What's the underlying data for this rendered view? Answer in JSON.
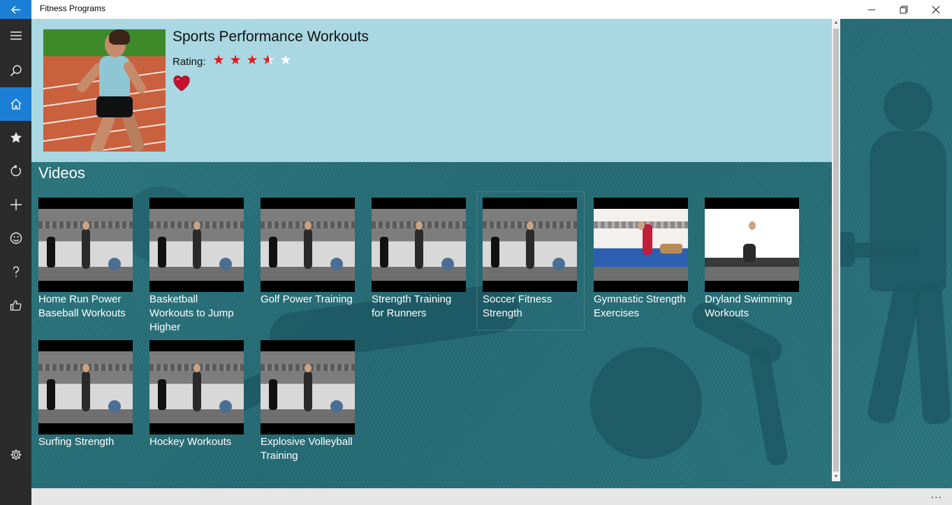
{
  "window": {
    "title": "Fitness Programs",
    "back_icon": "back-arrow-icon",
    "minimize_glyph": "—",
    "maximize_glyph": "❐",
    "close_glyph": "✕"
  },
  "nav": {
    "items": [
      {
        "name": "menu",
        "icon": "hamburger-icon",
        "active": false
      },
      {
        "name": "search",
        "icon": "search-icon",
        "active": false
      },
      {
        "name": "home",
        "icon": "home-icon",
        "active": true
      },
      {
        "name": "favorites",
        "icon": "star-icon",
        "active": false
      },
      {
        "name": "refresh",
        "icon": "refresh-icon",
        "active": false
      },
      {
        "name": "add",
        "icon": "plus-icon",
        "active": false
      },
      {
        "name": "feedback",
        "icon": "smiley-icon",
        "active": false
      },
      {
        "name": "help",
        "icon": "help-icon",
        "active": false
      },
      {
        "name": "like",
        "icon": "thumbs-up-icon",
        "active": false
      },
      {
        "name": "settings",
        "icon": "gear-icon",
        "active": false
      }
    ]
  },
  "header": {
    "title": "Sports Performance Workouts",
    "rating_label": "Rating:",
    "rating": 3.5,
    "rating_max": 5,
    "favorite_icon": "heart-icon",
    "colors": {
      "panel": "#a9d7e2",
      "star": "#e8141c",
      "heart": "#c8102e"
    }
  },
  "videos": {
    "section_title": "Videos",
    "items": [
      {
        "label": "Home Run Power Baseball Workouts"
      },
      {
        "label": "Basketball Workouts to Jump Higher"
      },
      {
        "label": "Golf Power Training"
      },
      {
        "label": "Strength Training for Runners"
      },
      {
        "label": "Soccer Fitness Strength"
      },
      {
        "label": "Gymnastic Strength Exercises"
      },
      {
        "label": "Dryland Swimming Workouts"
      },
      {
        "label": "Surfing Strength"
      },
      {
        "label": "Hockey Workouts"
      },
      {
        "label": "Explosive Volleyball Training"
      }
    ]
  },
  "bottombar": {
    "more_label": "..."
  },
  "colors": {
    "accent": "#1b7fd6",
    "nav_bg": "#2b2b2b",
    "content_bg": "#2a6f78"
  }
}
